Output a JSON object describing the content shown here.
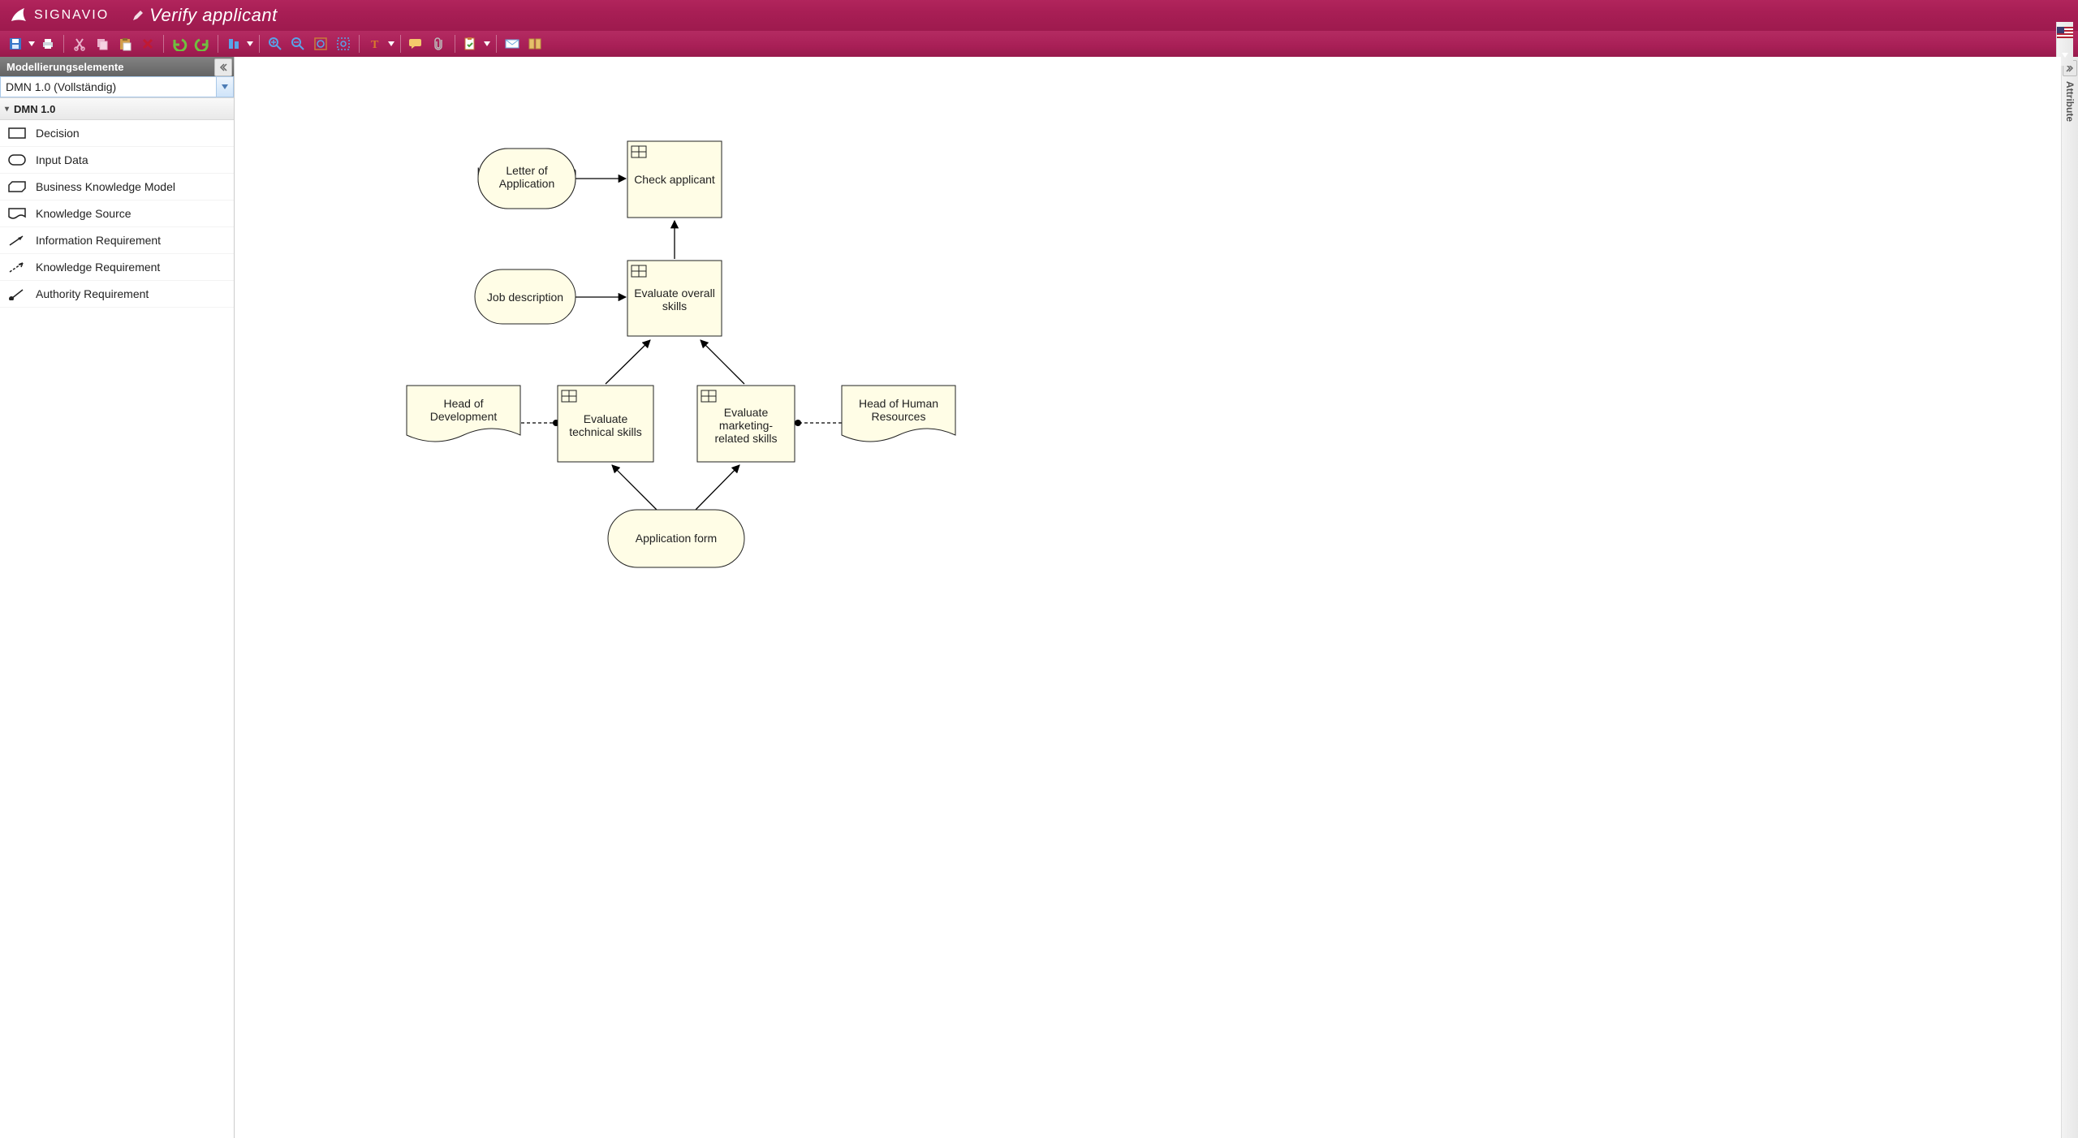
{
  "brand": {
    "name": "SIGNAVIO"
  },
  "header": {
    "title": "Verify applicant"
  },
  "toolbar": {
    "save": "Save",
    "print": "Print",
    "cut": "Cut",
    "copy": "Copy",
    "paste": "Paste",
    "delete": "Delete",
    "undo": "Undo",
    "redo": "Redo",
    "align": "Align",
    "zoomin": "Zoom In",
    "zoomout": "Zoom Out",
    "zoomfit": "Zoom Fit",
    "zoomregion": "Zoom Region",
    "text": "Text Format",
    "comment": "Comments",
    "attach": "Attachments",
    "check": "Check",
    "share": "Share",
    "dictionary": "Dictionary",
    "lang": "Language"
  },
  "leftPanel": {
    "title": "Modellierungselemente",
    "combo": "DMN 1.0 (Vollständig)",
    "groupTitle": "DMN 1.0",
    "items": [
      {
        "label": "Decision",
        "glyph": "decision"
      },
      {
        "label": "Input Data",
        "glyph": "input"
      },
      {
        "label": "Business Knowledge Model",
        "glyph": "bkm"
      },
      {
        "label": "Knowledge Source",
        "glyph": "ks"
      },
      {
        "label": "Information Requirement",
        "glyph": "info-req"
      },
      {
        "label": "Knowledge Requirement",
        "glyph": "know-req"
      },
      {
        "label": "Authority Requirement",
        "glyph": "auth-req"
      }
    ]
  },
  "commentCount": "0",
  "rightPanel": {
    "title": "Attribute"
  },
  "diagram": {
    "nodes": {
      "letter": {
        "label": "Letter of Application"
      },
      "jobdesc": {
        "label": "Job description"
      },
      "appform": {
        "label": "Application form"
      },
      "check": {
        "label": "Check applicant"
      },
      "overall": {
        "labelA": "Evaluate overall",
        "labelB": "skills"
      },
      "tech": {
        "labelA": "Evaluate",
        "labelB": "technical skills"
      },
      "mkt": {
        "labelA": "Evaluate",
        "labelB": "marketing-",
        "labelC": "related skills"
      },
      "hdev": {
        "labelA": "Head of",
        "labelB": "Development"
      },
      "hhr": {
        "labelA": "Head of Human",
        "labelB": "Resources"
      }
    }
  }
}
